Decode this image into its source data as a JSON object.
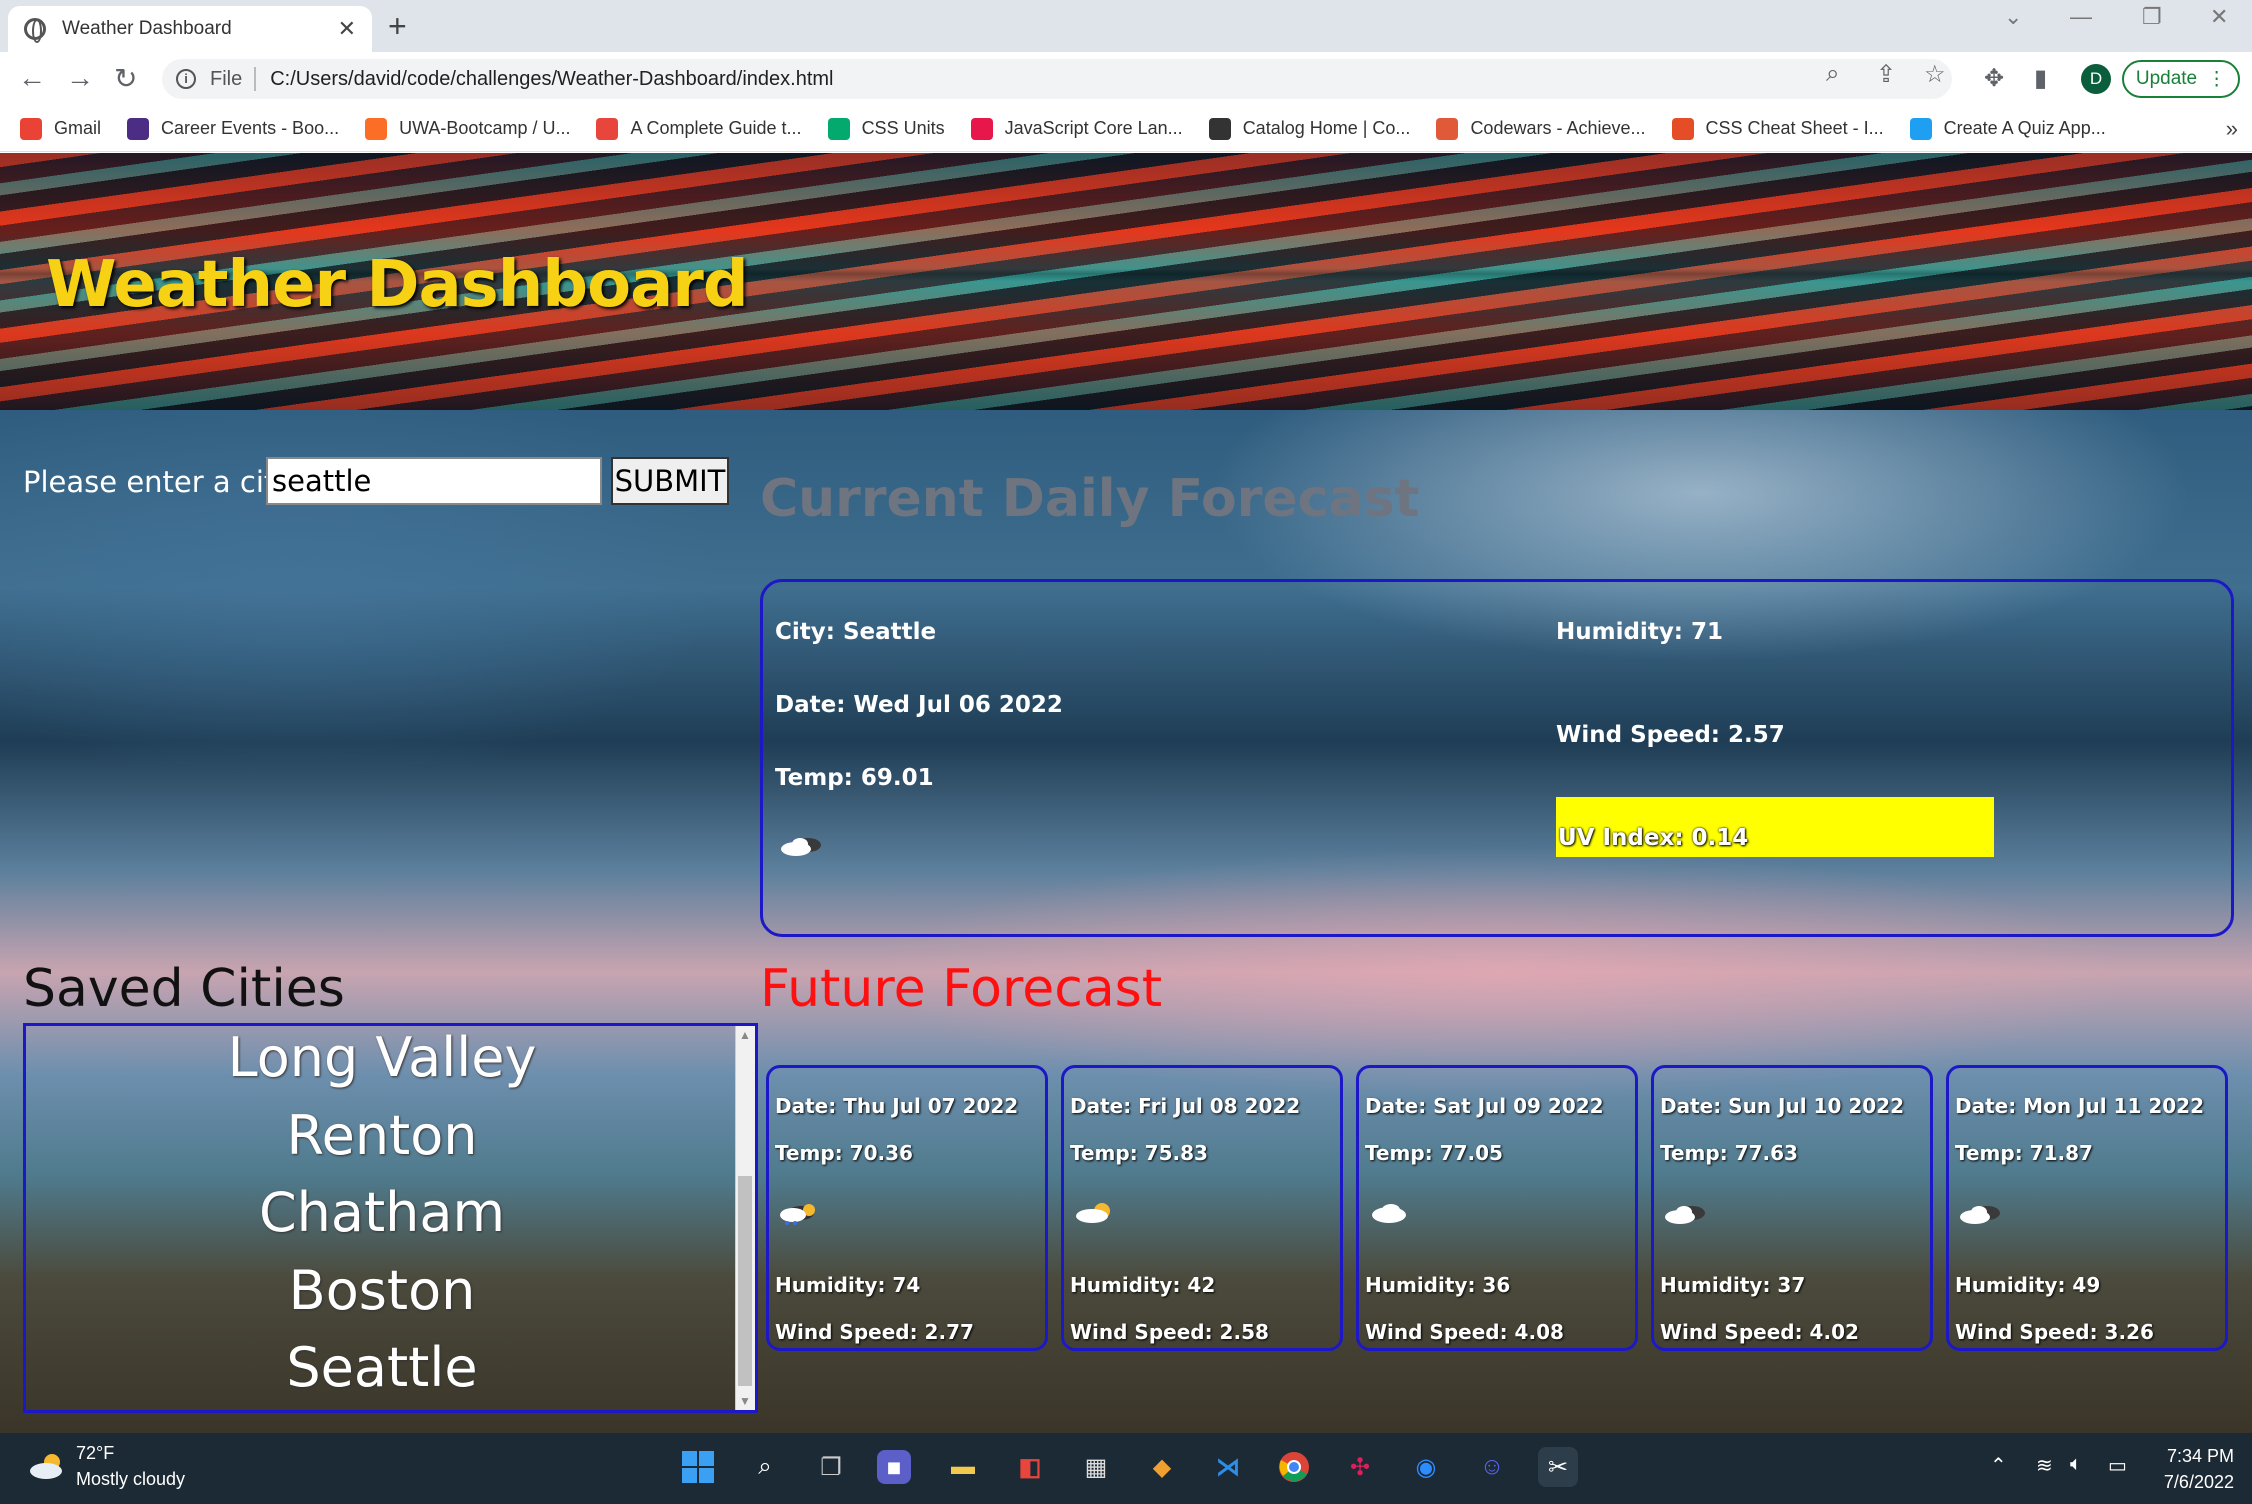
{
  "browser": {
    "tab_title": "Weather Dashboard",
    "url_scheme": "File",
    "url": "C:/Users/david/code/challenges/Weather-Dashboard/index.html",
    "profile_initial": "D",
    "update_label": "Update",
    "bookmarks": [
      {
        "label": "Gmail",
        "icon": "gmail-icon",
        "color": "#ea4335"
      },
      {
        "label": "Career Events - Boo...",
        "icon": "w-icon",
        "color": "#4b2e83"
      },
      {
        "label": "UWA-Bootcamp / U...",
        "icon": "gitlab-icon",
        "color": "#fc6d26"
      },
      {
        "label": "A Complete Guide t...",
        "icon": "asterisk-icon",
        "color": "#e8453c"
      },
      {
        "label": "CSS Units",
        "icon": "w3-icon",
        "color": "#04aa6d"
      },
      {
        "label": "JavaScript Core Lan...",
        "icon": "play-icon",
        "color": "#e8174b"
      },
      {
        "label": "Catalog Home | Co...",
        "icon": "c-icon",
        "color": "#333333"
      },
      {
        "label": "Codewars - Achieve...",
        "icon": "codewars-icon",
        "color": "#e05a3a"
      },
      {
        "label": "CSS Cheat Sheet - I...",
        "icon": "html5-icon",
        "color": "#e44d26"
      },
      {
        "label": "Create A Quiz App...",
        "icon": "cwm-icon",
        "color": "#1e9ff2"
      }
    ]
  },
  "app": {
    "title": "Weather Dashboard",
    "search": {
      "label": "Please enter a city",
      "value": "seattle",
      "submit_label": "SUBMIT"
    },
    "current": {
      "heading": "Current Daily Forecast",
      "city": "City: Seattle",
      "date": "Date: Wed Jul 06 2022",
      "temp": "Temp: 69.01",
      "humidity": "Humidity: 71",
      "wind": "Wind Speed: 2.57",
      "uv": "UV Index: 0.14",
      "uv_color": "#ffff00",
      "icon": "cloudy-icon"
    },
    "saved": {
      "heading": "Saved Cities",
      "cities": [
        "Long Valley",
        "Renton",
        "Chatham",
        "Boston",
        "Seattle"
      ]
    },
    "future": {
      "heading": "Future Forecast",
      "heading_color": "#ff1010",
      "days": [
        {
          "date": "Date: Thu Jul 07 2022",
          "temp": "Temp: 70.36",
          "humidity": "Humidity: 74",
          "wind": "Wind Speed: 2.77",
          "icon": "rain-sun-icon"
        },
        {
          "date": "Date: Fri Jul 08 2022",
          "temp": "Temp: 75.83",
          "humidity": "Humidity: 42",
          "wind": "Wind Speed: 2.58",
          "icon": "partly-sunny-icon"
        },
        {
          "date": "Date: Sat Jul 09 2022",
          "temp": "Temp: 77.05",
          "humidity": "Humidity: 36",
          "wind": "Wind Speed: 4.08",
          "icon": "cloud-icon"
        },
        {
          "date": "Date: Sun Jul 10 2022",
          "temp": "Temp: 77.63",
          "humidity": "Humidity: 37",
          "wind": "Wind Speed: 4.02",
          "icon": "cloudy-icon"
        },
        {
          "date": "Date: Mon Jul 11 2022",
          "temp": "Temp: 71.87",
          "humidity": "Humidity: 49",
          "wind": "Wind Speed: 3.26",
          "icon": "cloudy-icon"
        }
      ]
    }
  },
  "taskbar": {
    "weather_temp": "72°F",
    "weather_desc": "Mostly cloudy",
    "time": "7:34 PM",
    "date": "7/6/2022"
  }
}
